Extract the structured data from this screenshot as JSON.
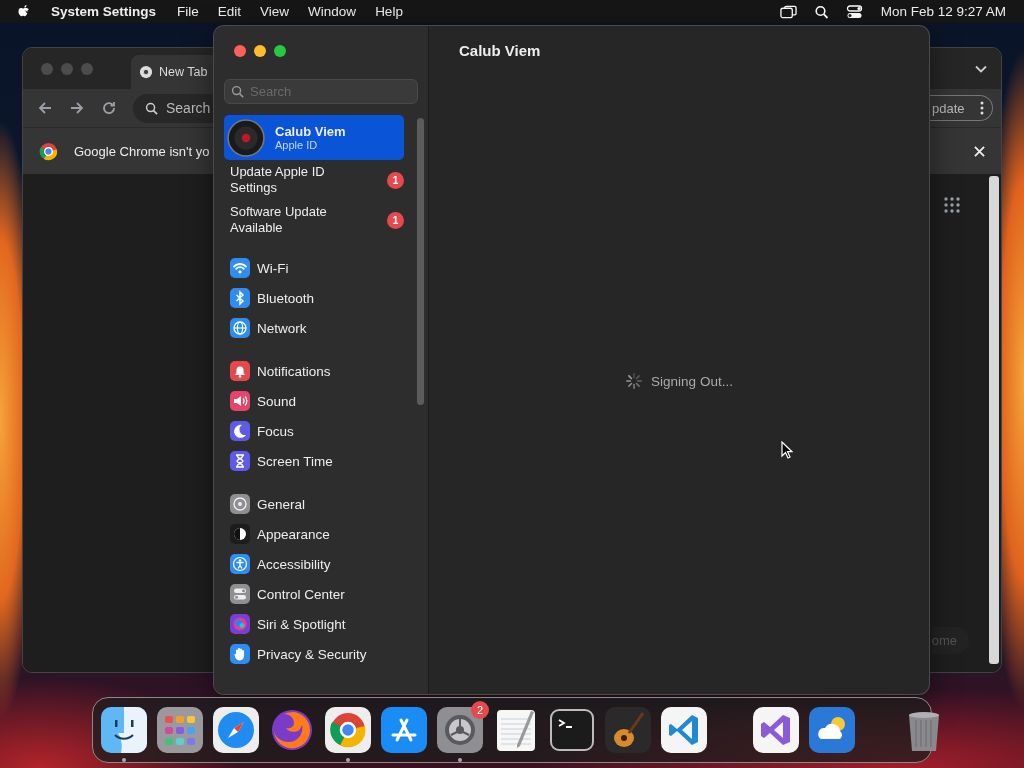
{
  "menubar": {
    "app": "System Settings",
    "menus": [
      "File",
      "Edit",
      "View",
      "Window",
      "Help"
    ],
    "clock": "Mon Feb 12  9:27 AM"
  },
  "browser": {
    "tab": "New Tab",
    "omnibox_placeholder": "Search",
    "infobar": "Google Chrome isn't yo",
    "update_button": "pdate",
    "bottom_button": "ome"
  },
  "settings": {
    "title": "Calub Viem",
    "search_placeholder": "Search",
    "account": {
      "name": "Calub Viem",
      "subtitle": "Apple ID",
      "selected": true
    },
    "notices": [
      {
        "label": "Update Apple ID Settings",
        "badge": "1"
      },
      {
        "label": "Software Update Available",
        "badge": "1"
      }
    ],
    "groups": [
      [
        {
          "label": "Wi-Fi",
          "kind": "wifi",
          "color": "#2f8cf0",
          "selected": false
        },
        {
          "label": "Bluetooth",
          "kind": "bluetooth",
          "color": "#2f8cf0",
          "selected": false
        },
        {
          "label": "Network",
          "kind": "network",
          "color": "#2f8cf0",
          "selected": false
        }
      ],
      [
        {
          "label": "Notifications",
          "kind": "bell",
          "color": "#e5484d",
          "selected": false
        },
        {
          "label": "Sound",
          "kind": "sound",
          "color": "#e8436a",
          "selected": false
        },
        {
          "label": "Focus",
          "kind": "moon",
          "color": "#5e5ce6",
          "selected": false
        },
        {
          "label": "Screen Time",
          "kind": "hourglass",
          "color": "#5e5ce6",
          "selected": false
        }
      ],
      [
        {
          "label": "General",
          "kind": "gear",
          "color": "#8e8e93",
          "selected": false
        },
        {
          "label": "Appearance",
          "kind": "appearance",
          "color": "#1c1c1e",
          "selected": false
        },
        {
          "label": "Accessibility",
          "kind": "accessibility",
          "color": "#2f8cf0",
          "selected": false
        },
        {
          "label": "Control Center",
          "kind": "toggles",
          "color": "#8e8e93",
          "selected": false
        },
        {
          "label": "Siri & Spotlight",
          "kind": "siri",
          "color": "#7a3fd0",
          "selected": false
        },
        {
          "label": "Privacy & Security",
          "kind": "hand",
          "color": "#2f8cf0",
          "selected": false
        }
      ]
    ],
    "status": "Signing Out..."
  },
  "dock": {
    "sections": [
      [
        {
          "kind": "finder",
          "running": true
        },
        {
          "kind": "launchpad",
          "running": false
        },
        {
          "kind": "safari",
          "running": false
        },
        {
          "kind": "firefox",
          "running": false
        },
        {
          "kind": "chrome",
          "running": true
        },
        {
          "kind": "appstore",
          "running": false
        },
        {
          "kind": "settings",
          "running": true,
          "badge": "2"
        },
        {
          "kind": "textedit",
          "running": false
        },
        {
          "kind": "terminal",
          "running": false
        },
        {
          "kind": "garageband",
          "running": false
        },
        {
          "kind": "vscode",
          "running": false
        }
      ],
      [
        {
          "kind": "visualstudio",
          "running": false
        },
        {
          "kind": "weather",
          "running": false
        }
      ],
      [
        {
          "kind": "trash",
          "running": false
        }
      ]
    ]
  }
}
